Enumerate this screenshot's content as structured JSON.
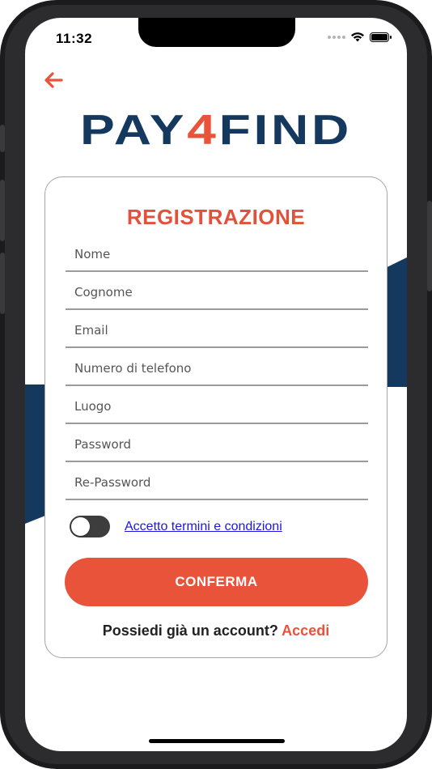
{
  "status_bar": {
    "time": "11:32",
    "icons": [
      "signal-dots-icon",
      "wifi-icon",
      "battery-icon"
    ]
  },
  "header": {
    "back_icon": "arrow-left-icon",
    "logo_text_left": "PAY",
    "logo_text_digit": "4",
    "logo_text_right": "FIND"
  },
  "form": {
    "title": "REGISTRAZIONE",
    "fields": [
      {
        "placeholder": "Nome",
        "value": ""
      },
      {
        "placeholder": "Cognome",
        "value": ""
      },
      {
        "placeholder": "Email",
        "value": ""
      },
      {
        "placeholder": "Numero di telefono",
        "value": ""
      },
      {
        "placeholder": "Luogo",
        "value": ""
      },
      {
        "placeholder": "Password",
        "value": ""
      },
      {
        "placeholder": "Re-Password",
        "value": ""
      }
    ],
    "terms_label": "Accetto termini e condizioni",
    "terms_accepted": false,
    "confirm_label": "CONFERMA",
    "login_prompt": "Possiedi già un account?",
    "login_link": "Accedi"
  },
  "colors": {
    "accent": "#e8533a",
    "navy": "#14385e",
    "link": "#1a16e8",
    "toggle_off": "#3d3d3d"
  }
}
